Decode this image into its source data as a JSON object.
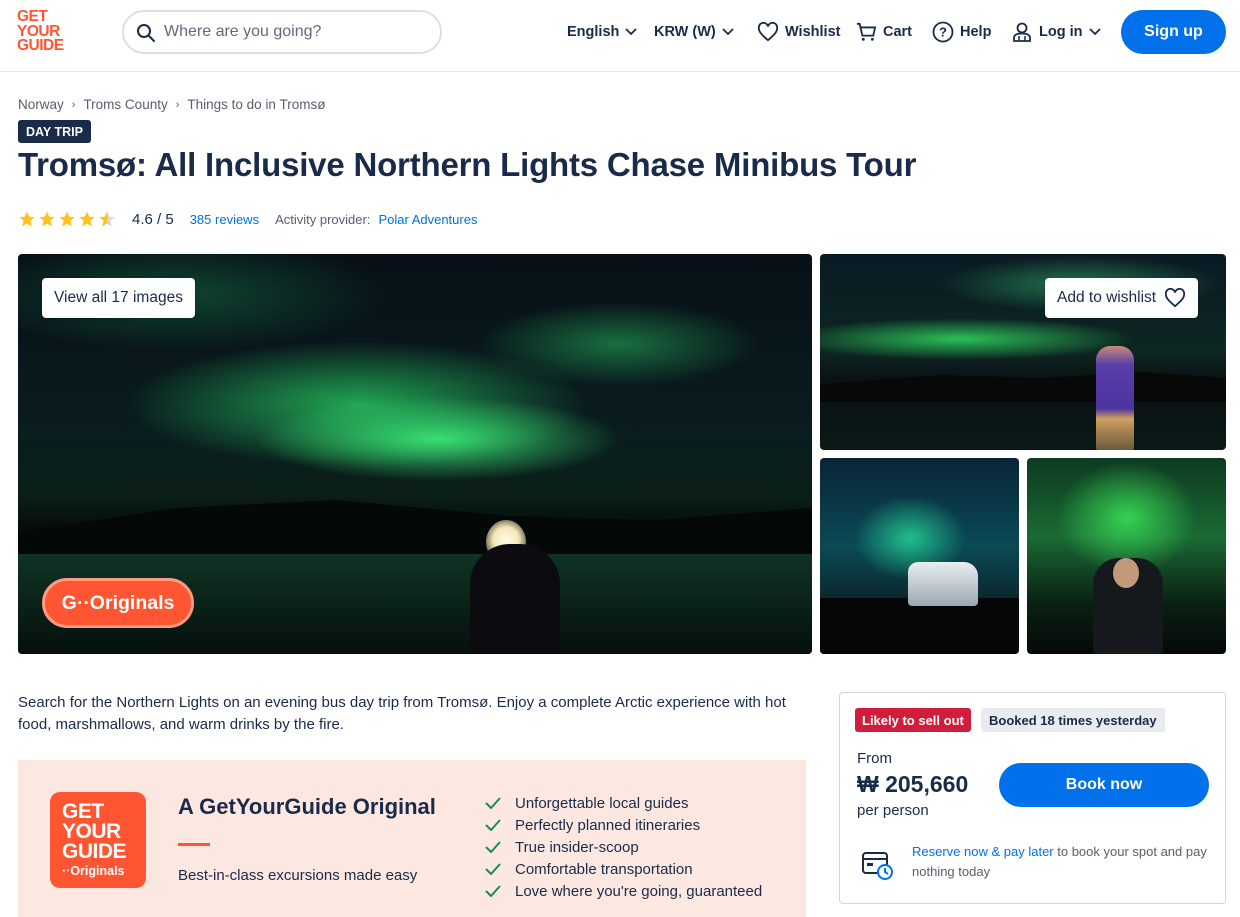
{
  "header": {
    "logo_lines": [
      "GET",
      "YOUR",
      "GUIDE"
    ],
    "search_placeholder": "Where are you going?",
    "language": "English",
    "currency": "KRW (W)",
    "wishlist": "Wishlist",
    "cart": "Cart",
    "help": "Help",
    "login": "Log in",
    "signup": "Sign up"
  },
  "breadcrumb": [
    "Norway",
    "Troms County",
    "Things to do in Tromsø"
  ],
  "badge": "DAY TRIP",
  "title": "Tromsø: All Inclusive Northern Lights Chase Minibus Tour",
  "rating": {
    "value": 4.6,
    "text": "4.6 / 5",
    "reviews": "385 reviews",
    "provider_label": "Activity provider:",
    "provider": "Polar Adventures"
  },
  "gallery": {
    "view_all": "View all 17 images",
    "add_wishlist": "Add to wishlist",
    "originals_badge": "G··Originals"
  },
  "description": "Search for the Northern Lights on an evening bus day trip from Tromsø. Enjoy a complete Arctic experience with hot food, marshmallows, and warm drinks by the fire.",
  "original": {
    "logo_lines": [
      "GET",
      "YOUR",
      "GUIDE"
    ],
    "logo_sub": "··Originals",
    "title": "A GetYourGuide Original",
    "subtitle": "Best-in-class excursions made easy",
    "features": [
      "Unforgettable local guides",
      "Perfectly planned itineraries",
      "True insider-scoop",
      "Comfortable transportation",
      "Love where you're going, guaranteed"
    ]
  },
  "booking": {
    "tag_sell_out": "Likely to sell out",
    "tag_booked": "Booked 18 times yesterday",
    "from": "From",
    "price": "₩ 205,660",
    "per": "per person",
    "book_now": "Book now",
    "reserve_link": "Reserve now & pay later",
    "reserve_rest": " to book your spot and pay nothing today"
  },
  "colors": {
    "brand": "#ff5533",
    "accent": "#0071eb",
    "text": "#1a2b49",
    "star": "#fcc419",
    "sell_out": "#d21c3c"
  }
}
